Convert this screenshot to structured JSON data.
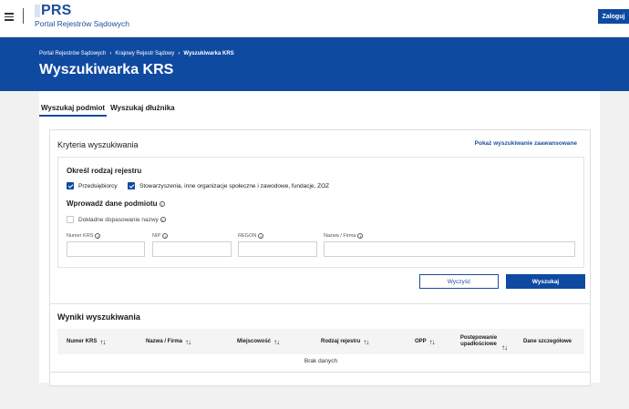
{
  "topbar": {
    "logo": "PRS",
    "logo_sub": "Portal Rejestrów Sądowych",
    "login_label": "Zaloguj"
  },
  "breadcrumbs": [
    "Portal Rejestrów Sądowych",
    "Krajowy Rejestr Sądowy",
    "Wyszukiwarka KRS"
  ],
  "page_title": "Wyszukiwarka KRS",
  "tabs": [
    {
      "label": "Wyszukaj podmiot",
      "active": true
    },
    {
      "label": "Wyszukaj dłużnika",
      "active": false
    }
  ],
  "criteria": {
    "title": "Kryteria wyszukiwania",
    "advanced_link": "Pokaż wyszukiwanie zaawansowane",
    "register_type_title": "Określ rodzaj rejestru",
    "register_options": [
      {
        "label": "Przedsiębiorcy",
        "checked": true
      },
      {
        "label": "Stowarzyszenia, inne organizacje społeczne i zawodowe, fundacje, ZOZ",
        "checked": true
      }
    ],
    "entity_title": "Wprowadź dane podmiotu",
    "exact_match_label": "Dokładne dopasowanie nazwy",
    "exact_match_checked": false,
    "fields": [
      {
        "label": "Numer KRS",
        "value": ""
      },
      {
        "label": "NIP",
        "value": ""
      },
      {
        "label": "REGON",
        "value": ""
      },
      {
        "label": "Nazwa / Firma",
        "value": ""
      }
    ],
    "clear_label": "Wyczyść",
    "search_label": "Wyszukaj"
  },
  "results": {
    "title": "Wyniki wyszukiwania",
    "columns": [
      "Numer KRS",
      "Nazwa / Firma",
      "Miejscowość",
      "Rodzaj rejestru",
      "OPP",
      "Postępowanie upadłościowe",
      "Dane szczegółowe"
    ],
    "empty_text": "Brak danych"
  },
  "colors": {
    "brand": "#0f4aa1",
    "link": "#1f4c9c",
    "background": "#f1f1f1"
  },
  "icons": {
    "menu": "hamburger-icon",
    "info": "info-circle-icon",
    "sort": "sort-arrows-icon",
    "breadcrumb_sep": "chevron-right-icon"
  }
}
